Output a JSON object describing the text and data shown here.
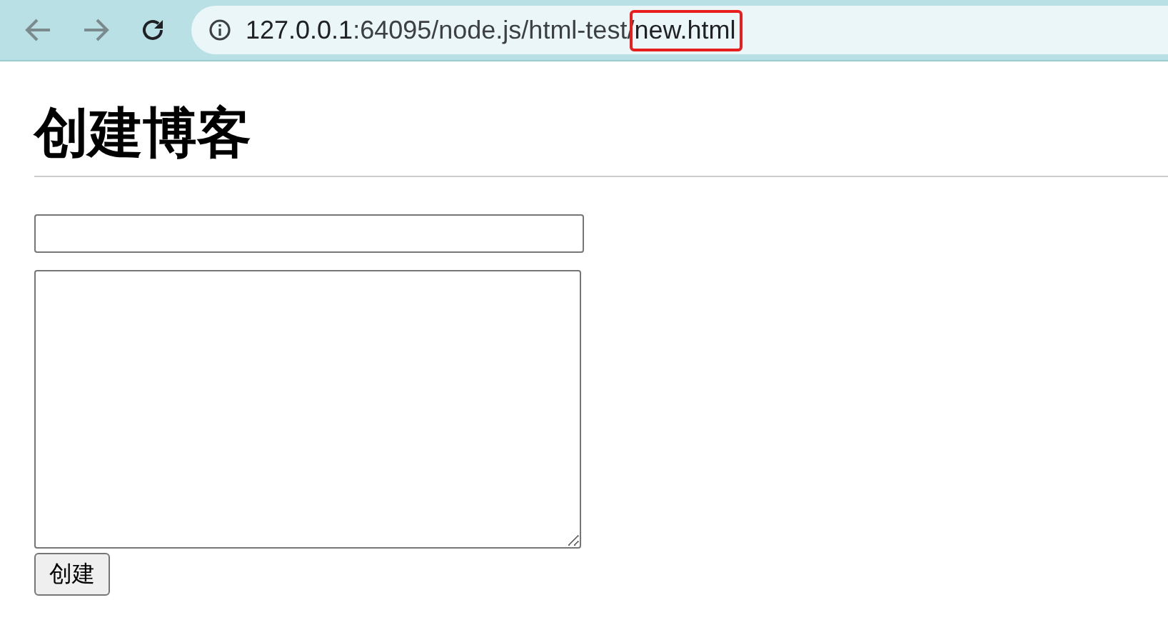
{
  "address_bar": {
    "host": "127.0.0.1",
    "path": ":64095/node.js/html-test/",
    "highlighted_part": "new.html"
  },
  "heading": "创建博客",
  "form": {
    "button": "创建"
  }
}
